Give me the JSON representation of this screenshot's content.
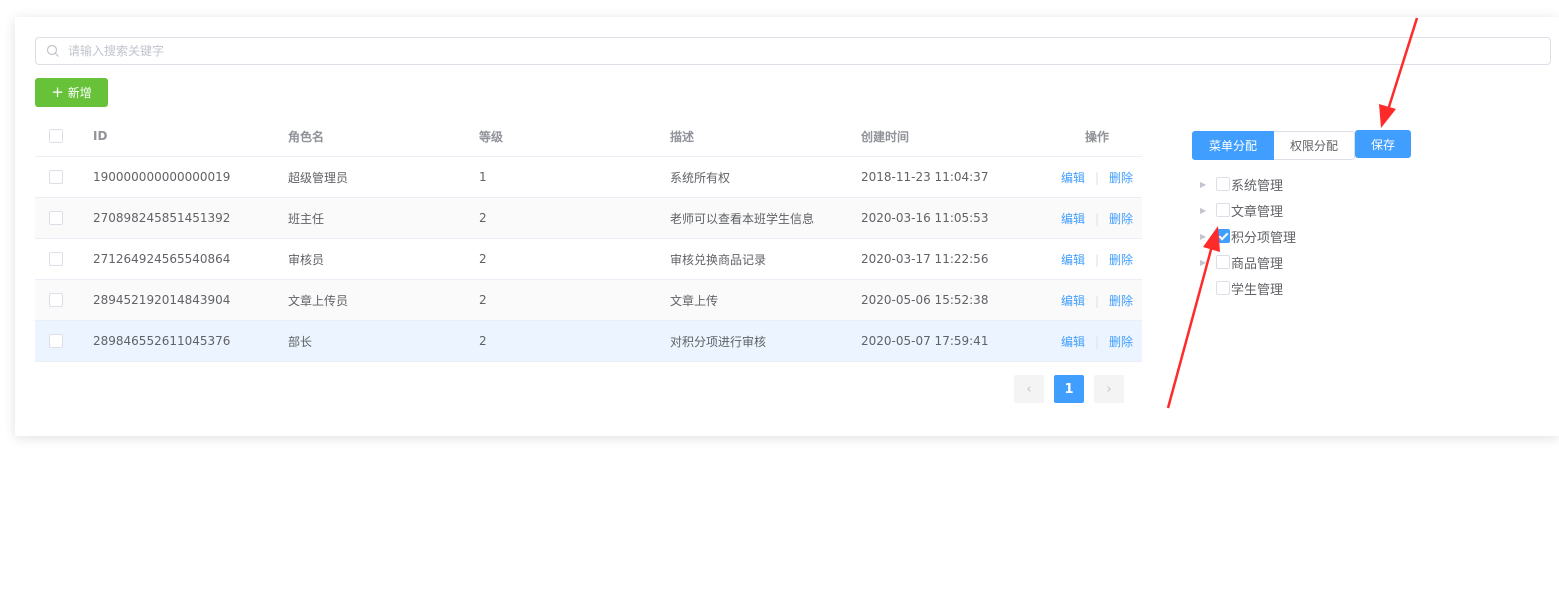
{
  "search": {
    "placeholder": "请输入搜索关键字"
  },
  "toolbar": {
    "add_label": "新增"
  },
  "table": {
    "columns": [
      "ID",
      "角色名",
      "等级",
      "描述",
      "创建时间",
      "操作"
    ],
    "rows": [
      {
        "id": "190000000000000019",
        "name": "超级管理员",
        "level": "1",
        "desc": "系统所有权",
        "created": "2018-11-23 11:04:37"
      },
      {
        "id": "270898245851451392",
        "name": "班主任",
        "level": "2",
        "desc": "老师可以查看本班学生信息",
        "created": "2020-03-16 11:05:53"
      },
      {
        "id": "271264924565540864",
        "name": "审核员",
        "level": "2",
        "desc": "审核兑换商品记录",
        "created": "2020-03-17 11:22:56"
      },
      {
        "id": "289452192014843904",
        "name": "文章上传员",
        "level": "2",
        "desc": "文章上传",
        "created": "2020-05-06 15:52:38"
      },
      {
        "id": "289846552611045376",
        "name": "部长",
        "level": "2",
        "desc": "对积分项进行审核",
        "created": "2020-05-07 17:59:41"
      }
    ],
    "edit_label": "编辑",
    "delete_label": "删除"
  },
  "pagination": {
    "current": "1"
  },
  "panel": {
    "tabs": [
      "菜单分配",
      "权限分配"
    ],
    "save_label": "保存",
    "tree": [
      {
        "label": "系统管理",
        "checked": false,
        "has_children": true
      },
      {
        "label": "文章管理",
        "checked": false,
        "has_children": true
      },
      {
        "label": "积分项管理",
        "checked": true,
        "has_children": true
      },
      {
        "label": "商品管理",
        "checked": false,
        "has_children": true
      },
      {
        "label": "学生管理",
        "checked": false,
        "has_children": false
      }
    ]
  },
  "colors": {
    "primary": "#409eff",
    "success": "#67c23a",
    "annotation": "#ff2a2a"
  }
}
